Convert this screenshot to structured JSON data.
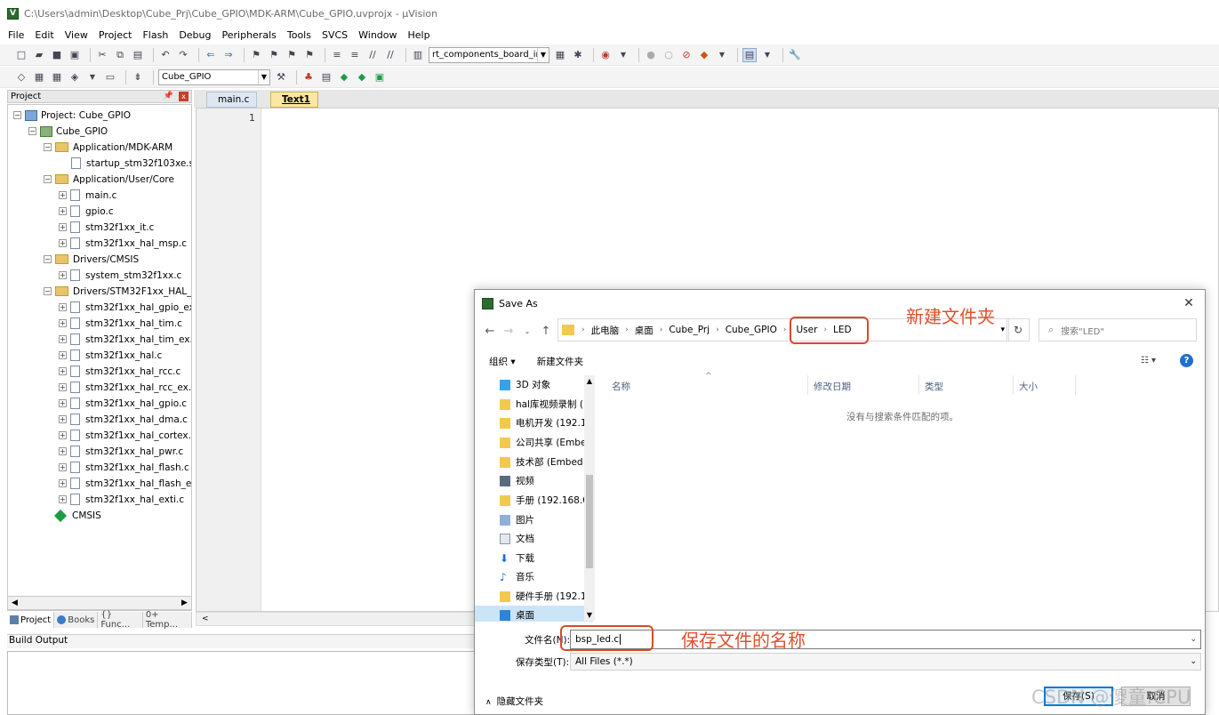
{
  "window": {
    "title": "C:\\Users\\admin\\Desktop\\Cube_Prj\\Cube_GPIO\\MDK-ARM\\Cube_GPIO.uvprojx - µVision"
  },
  "menu": [
    "File",
    "Edit",
    "View",
    "Project",
    "Flash",
    "Debug",
    "Peripherals",
    "Tools",
    "SVCS",
    "Window",
    "Help"
  ],
  "toolbar": {
    "find_combo": "rt_components_board_in",
    "target_combo": "Cube_GPIO"
  },
  "project_panel": {
    "title": "Project",
    "tree": [
      {
        "label": "Project: Cube_GPIO"
      },
      {
        "label": "Cube_GPIO"
      },
      {
        "label": "Application/MDK-ARM"
      },
      {
        "label": "startup_stm32f103xe.s"
      },
      {
        "label": "Application/User/Core"
      },
      {
        "label": "main.c"
      },
      {
        "label": "gpio.c"
      },
      {
        "label": "stm32f1xx_it.c"
      },
      {
        "label": "stm32f1xx_hal_msp.c"
      },
      {
        "label": "Drivers/CMSIS"
      },
      {
        "label": "system_stm32f1xx.c"
      },
      {
        "label": "Drivers/STM32F1xx_HAL_Driv"
      },
      {
        "label": "stm32f1xx_hal_gpio_ex.c"
      },
      {
        "label": "stm32f1xx_hal_tim.c"
      },
      {
        "label": "stm32f1xx_hal_tim_ex.c"
      },
      {
        "label": "stm32f1xx_hal.c"
      },
      {
        "label": "stm32f1xx_hal_rcc.c"
      },
      {
        "label": "stm32f1xx_hal_rcc_ex.c"
      },
      {
        "label": "stm32f1xx_hal_gpio.c"
      },
      {
        "label": "stm32f1xx_hal_dma.c"
      },
      {
        "label": "stm32f1xx_hal_cortex.c"
      },
      {
        "label": "stm32f1xx_hal_pwr.c"
      },
      {
        "label": "stm32f1xx_hal_flash.c"
      },
      {
        "label": "stm32f1xx_hal_flash_ex.c"
      },
      {
        "label": "stm32f1xx_hal_exti.c"
      },
      {
        "label": "CMSIS"
      }
    ],
    "tabs": [
      "Project",
      "Books",
      "{} Func...",
      "0+ Temp..."
    ]
  },
  "editor": {
    "tabs": [
      "main.c",
      "Text1"
    ],
    "line_number": "1"
  },
  "build_output": {
    "title": "Build Output"
  },
  "dialog": {
    "title": "Save As",
    "breadcrumbs": [
      "此电脑",
      "桌面",
      "Cube_Prj",
      "Cube_GPIO",
      "User",
      "LED"
    ],
    "search_placeholder": "搜索\"LED\"",
    "organize": "组织 ▾",
    "new_folder": "新建文件夹",
    "nav_items": [
      "3D 对象",
      "hal库视频录制 (",
      "电机开发 (192.1",
      "公司共享 (Embe",
      "技术部 (Embed",
      "视频",
      "手册 (192.168.0",
      "图片",
      "文档",
      "下载",
      "音乐",
      "硬件手册 (192.1",
      "桌面"
    ],
    "columns": [
      "名称",
      "修改日期",
      "类型",
      "大小"
    ],
    "empty_message": "没有与搜索条件匹配的项。",
    "filename_label": "文件名(N):",
    "filename_value": "bsp_led.c",
    "filetype_label": "保存类型(T):",
    "filetype_value": "All Files (*.*)",
    "hide_folders": "隐藏文件夹",
    "save_label": "保存(S)",
    "cancel_label": "取消"
  },
  "annotations": {
    "new_folder_note": "新建文件夹",
    "filename_note": "保存文件的名称",
    "accent": "#d84a2b"
  },
  "watermark": "CSDN @傻童:CPU"
}
